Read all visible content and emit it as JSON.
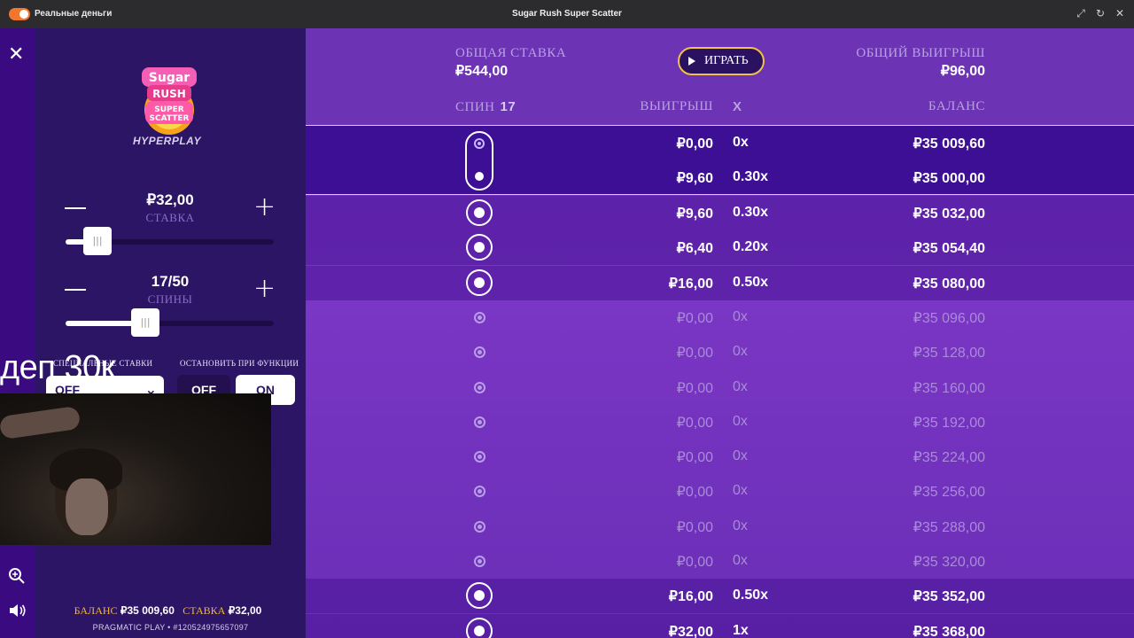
{
  "window": {
    "mode_label": "Реальные деньги",
    "title": "Sugar Rush Super Scatter",
    "icons": [
      "expand-icon",
      "refresh-icon",
      "close-icon"
    ]
  },
  "sidebar": {
    "logo_text": "Sugar Rush Super Scatter",
    "logo_brand": "HYPERPLAY",
    "bet": {
      "value": "₽32,00",
      "caption": "СТАВКА",
      "slider_level": 0.11
    },
    "spins": {
      "value": "17/50",
      "caption": "СПИНЫ",
      "slider_level": 0.34
    },
    "special_bets_label": "СПЕЦИАЛЬНЫЕ СТАВКИ",
    "special_bets_value": "OFF",
    "stop_on_feature_label": "ОСТАНОВИТЬ ПРИ ФУНКЦИИ",
    "stop_off": "OFF",
    "stop_on": "ON",
    "overlay_text": "деп 30к",
    "status": {
      "balance_label": "БАЛАНС",
      "balance_value": "₽35 009,60",
      "bet_label": "СТАВКА",
      "bet_value": "₽32,00"
    },
    "footer": "PRAGMATIC PLAY • #120524975657097"
  },
  "main": {
    "total_bet_label": "ОБЩАЯ СТАВКА",
    "total_bet_value": "₽544,00",
    "play_label": "ИГРАТЬ",
    "total_win_label": "ОБЩИЙ ВЫИГРЫШ",
    "total_win_value": "₽96,00",
    "columns": {
      "spin": "СПИН",
      "spin_count": "17",
      "win": "ВЫИГРЫШ",
      "mult": "X",
      "balance": "БАЛАНС"
    },
    "group_rows": [
      {
        "win": "₽0,00",
        "mult": "0x",
        "balance": "₽35 009,60"
      },
      {
        "win": "₽9,60",
        "mult": "0.30x",
        "balance": "₽35 000,00"
      }
    ],
    "rows": [
      {
        "win": "₽9,60",
        "mult": "0.30x",
        "balance": "₽35 032,00",
        "state": "bright"
      },
      {
        "win": "₽6,40",
        "mult": "0.20x",
        "balance": "₽35 054,40",
        "state": "bright"
      },
      {
        "win": "₽16,00",
        "mult": "0.50x",
        "balance": "₽35 080,00",
        "state": "bright"
      },
      {
        "win": "₽0,00",
        "mult": "0x",
        "balance": "₽35 096,00",
        "state": "dim"
      },
      {
        "win": "₽0,00",
        "mult": "0x",
        "balance": "₽35 128,00",
        "state": "dim"
      },
      {
        "win": "₽0,00",
        "mult": "0x",
        "balance": "₽35 160,00",
        "state": "dim"
      },
      {
        "win": "₽0,00",
        "mult": "0x",
        "balance": "₽35 192,00",
        "state": "dim"
      },
      {
        "win": "₽0,00",
        "mult": "0x",
        "balance": "₽35 224,00",
        "state": "dim"
      },
      {
        "win": "₽0,00",
        "mult": "0x",
        "balance": "₽35 256,00",
        "state": "dim"
      },
      {
        "win": "₽0,00",
        "mult": "0x",
        "balance": "₽35 288,00",
        "state": "dim"
      },
      {
        "win": "₽0,00",
        "mult": "0x",
        "balance": "₽35 320,00",
        "state": "dim"
      },
      {
        "win": "₽16,00",
        "mult": "0.50x",
        "balance": "₽35 352,00",
        "state": "bright"
      },
      {
        "win": "₽32,00",
        "mult": "1x",
        "balance": "₽35 368,00",
        "state": "bright"
      }
    ]
  },
  "colors": {
    "accent": "#f0772c",
    "gold": "#f2b632",
    "panel": "#2d1565",
    "main": "#6a2fb8"
  }
}
